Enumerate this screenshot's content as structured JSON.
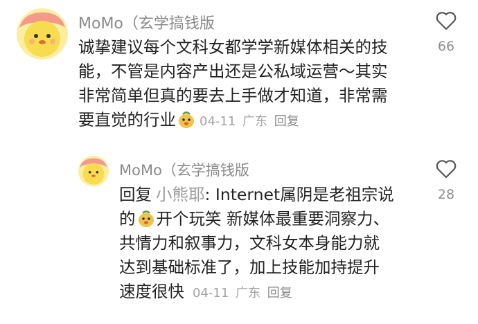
{
  "comment": {
    "author": "MoMo（玄学搞钱版",
    "lines": [
      "诚挚建议每个文科女都学学新媒体相关的技",
      "能，不管是内容产出还是公私域运营～其实",
      "非常简单但真的要去上手做才知道，非常需",
      "要直觉的行业"
    ],
    "date": "04-11",
    "location": "广东",
    "reply_label": "回复",
    "likes": "66",
    "emoji_icon": "cute-face-emoji"
  },
  "reply": {
    "author": "MoMo（玄学搞钱版",
    "reply_prefix": "回复",
    "mention": "小熊耶",
    "line1_rest": ": Internet属阴是老祖宗说",
    "line2_a": "的",
    "line2_b": "开个玩笑 新媒体最重要洞察力、",
    "lines": [
      "共情力和叙事力，文科女本身能力就",
      "达到基础标准了，加上技能加持提升"
    ],
    "last_line": "速度很快",
    "date": "04-11",
    "location": "广东",
    "reply_label": "回复",
    "likes": "28",
    "emoji_icon": "cute-face-emoji"
  },
  "colors": {
    "avatar_bg": "#f7e46b",
    "emoji_face": "#f0c44a"
  }
}
